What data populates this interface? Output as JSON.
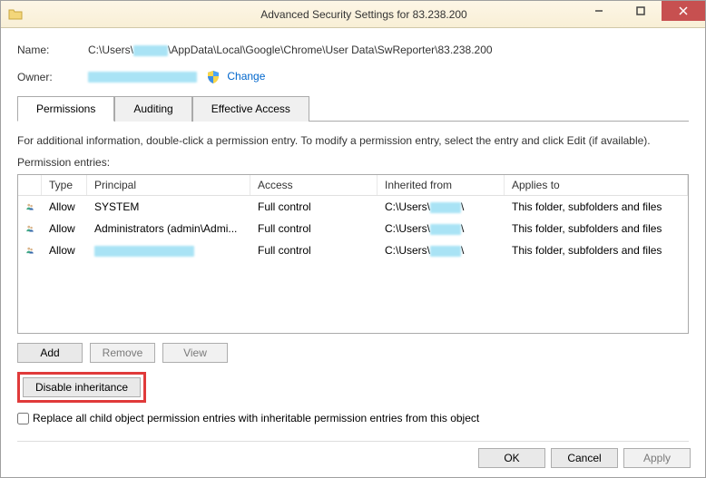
{
  "title": "Advanced Security Settings for 83.238.200",
  "labels": {
    "name": "Name:",
    "owner": "Owner:",
    "change": "Change",
    "info": "For additional information, double-click a permission entry. To modify a permission entry, select the entry and click Edit (if available).",
    "entries": "Permission entries:",
    "add": "Add",
    "remove": "Remove",
    "view": "View",
    "disable_inh": "Disable inheritance",
    "replace": "Replace all child object permission entries with inheritable permission entries from this object",
    "ok": "OK",
    "cancel": "Cancel",
    "apply": "Apply"
  },
  "path_prefix": "C:\\Users\\",
  "path_suffix": "\\AppData\\Local\\Google\\Chrome\\User Data\\SwReporter\\83.238.200",
  "tabs": [
    {
      "label": "Permissions",
      "active": true
    },
    {
      "label": "Auditing",
      "active": false
    },
    {
      "label": "Effective Access",
      "active": false
    }
  ],
  "columns": {
    "type": "Type",
    "principal": "Principal",
    "access": "Access",
    "inherited": "Inherited from",
    "applies": "Applies to"
  },
  "entries": [
    {
      "type": "Allow",
      "principal": "SYSTEM",
      "principal_redacted": false,
      "access": "Full control",
      "inh_prefix": "C:\\Users\\",
      "applies": "This folder, subfolders and files"
    },
    {
      "type": "Allow",
      "principal": "Administrators (admin\\Admi...",
      "principal_redacted": false,
      "access": "Full control",
      "inh_prefix": "C:\\Users\\",
      "applies": "This folder, subfolders and files"
    },
    {
      "type": "Allow",
      "principal": "",
      "principal_redacted": true,
      "access": "Full control",
      "inh_prefix": "C:\\Users\\",
      "applies": "This folder, subfolders and files"
    }
  ]
}
